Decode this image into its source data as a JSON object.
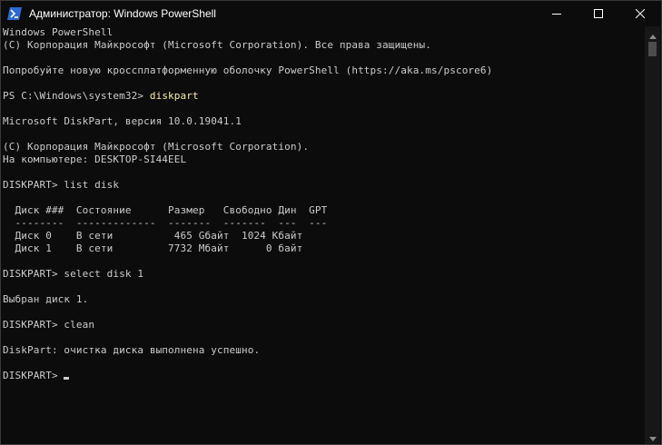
{
  "window": {
    "title": "Администратор: Windows PowerShell",
    "icon": "powershell-icon"
  },
  "controls": {
    "minimize_icon": "minimize-icon",
    "maximize_icon": "maximize-icon",
    "close_icon": "close-icon"
  },
  "console": {
    "lines": [
      {
        "text": "Windows PowerShell"
      },
      {
        "text": "(C) Корпорация Майкрософт (Microsoft Corporation). Все права защищены."
      },
      {
        "text": ""
      },
      {
        "text": "Попробуйте новую кроссплатформенную оболочку PowerShell (https://aka.ms/pscore6)"
      },
      {
        "text": ""
      },
      {
        "prompt": "PS C:\\Windows\\system32> ",
        "command": "diskpart"
      },
      {
        "text": ""
      },
      {
        "text": "Microsoft DiskPart, версия 10.0.19041.1"
      },
      {
        "text": ""
      },
      {
        "text": "(C) Корпорация Майкрософт (Microsoft Corporation)."
      },
      {
        "text": "На компьютере: DESKTOP-SI44EEL"
      },
      {
        "text": ""
      },
      {
        "text": "DISKPART> list disk"
      },
      {
        "text": ""
      },
      {
        "text": "  Диск ###  Состояние      Размер   Свободно Дин  GPT"
      },
      {
        "text": "  --------  -------------  -------  -------  ---  ---"
      },
      {
        "text": "  Диск 0    В сети          465 Gбайт  1024 Кбайт"
      },
      {
        "text": "  Диск 1    В сети         7732 Мбайт      0 байт"
      },
      {
        "text": ""
      },
      {
        "text": "DISKPART> select disk 1"
      },
      {
        "text": ""
      },
      {
        "text": "Выбран диск 1."
      },
      {
        "text": ""
      },
      {
        "text": "DISKPART> clean"
      },
      {
        "text": ""
      },
      {
        "text": "DiskPart: очистка диска выполнена успешно."
      },
      {
        "text": ""
      },
      {
        "text": "DISKPART> ",
        "cursor": true
      }
    ]
  },
  "scrollbar": {
    "up_icon": "scroll-up-arrow-icon",
    "down_icon": "scroll-down-arrow-icon"
  },
  "colors": {
    "background": "#0c0c0c",
    "foreground": "#cccccc",
    "command": "#f9f1a5"
  }
}
